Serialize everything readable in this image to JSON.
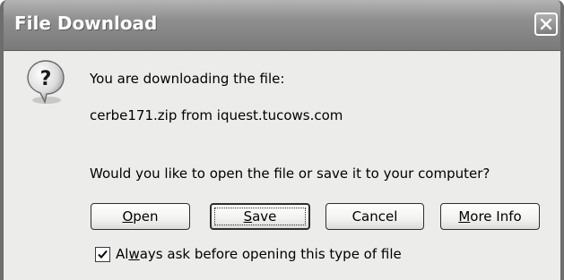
{
  "window": {
    "title": "File Download",
    "close_icon": "close-icon"
  },
  "dialog": {
    "icon": "question-icon",
    "line1": "You are downloading the file:",
    "line2": "cerbe171.zip from iquest.tucows.com",
    "question": "Would you like to open the file or save it to your computer?"
  },
  "buttons": {
    "open": {
      "access_key": "O",
      "rest": "pen"
    },
    "save": {
      "access_key": "S",
      "rest": "ave"
    },
    "cancel": {
      "label": "Cancel"
    },
    "more_info": {
      "access_key": "M",
      "rest": "ore Info"
    }
  },
  "checkbox": {
    "checked": true,
    "label_before": "Al",
    "access_key": "w",
    "label_after": "ays ask before opening this type of file"
  },
  "colors": {
    "titlebar": "#8e8e8e",
    "dialog_background": "#ececea",
    "text": "#000000"
  }
}
